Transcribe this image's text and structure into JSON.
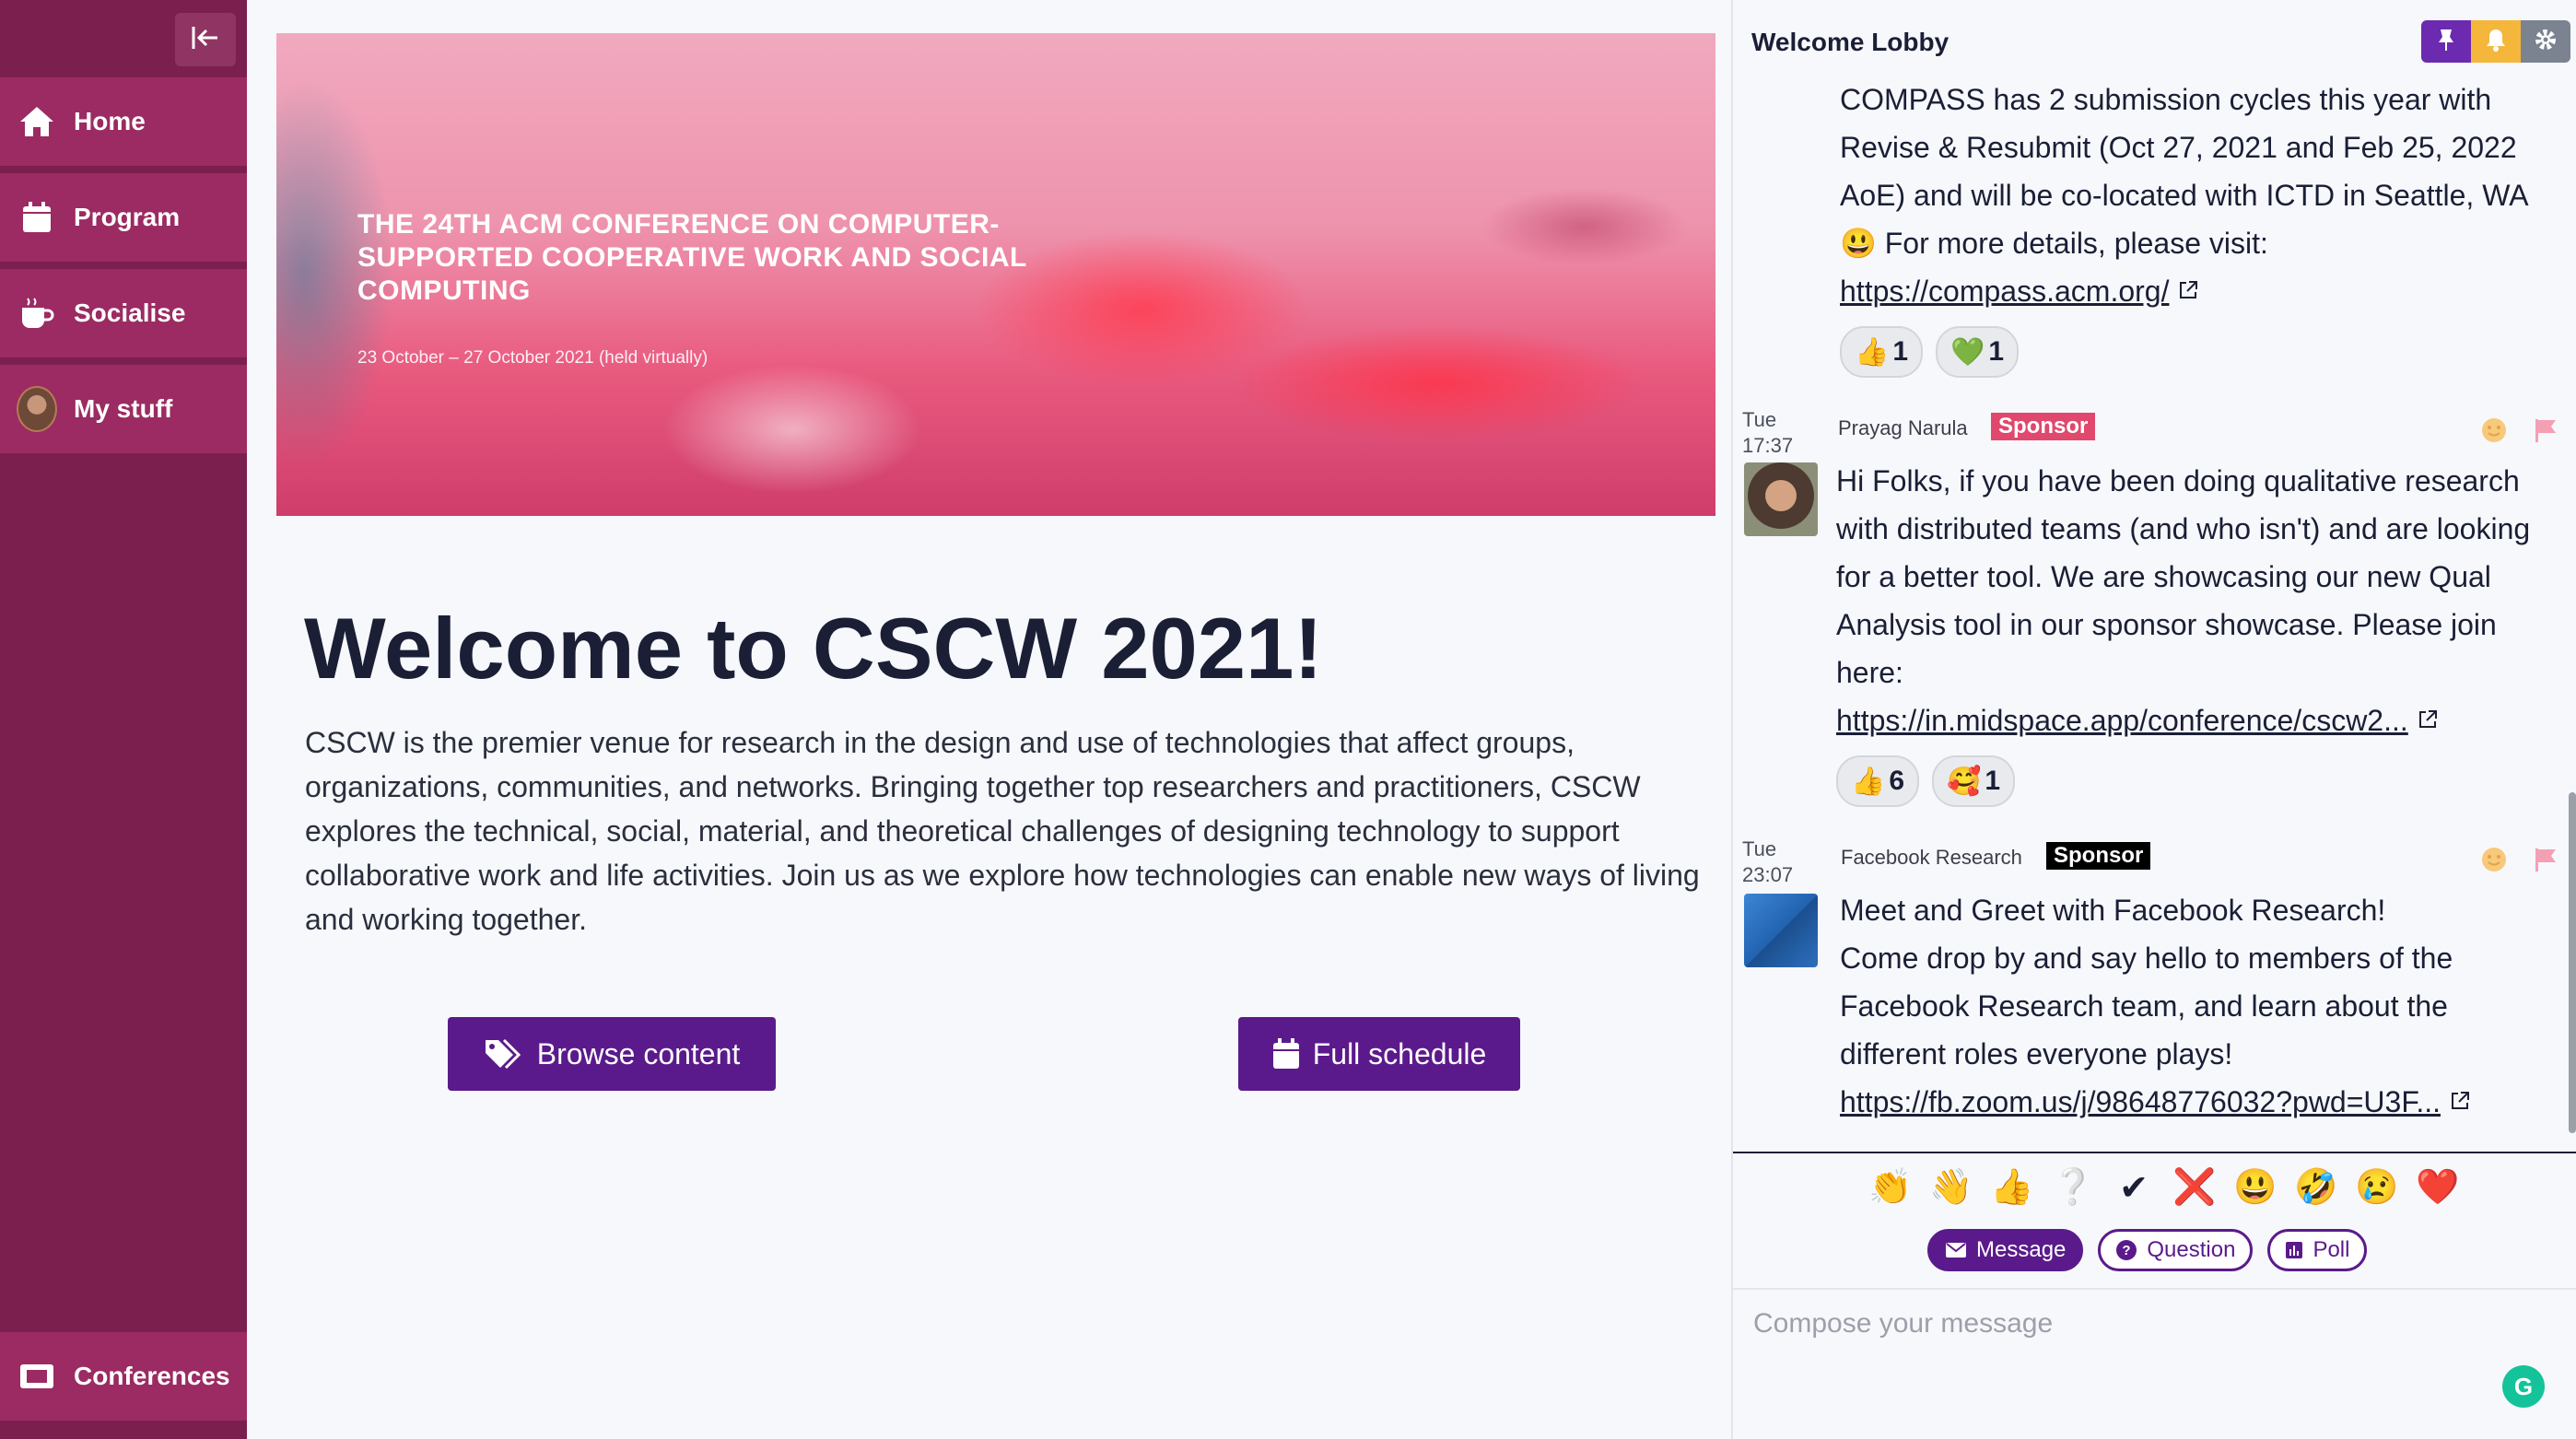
{
  "sidebar": {
    "items": [
      {
        "label": "Home",
        "icon": "home-icon"
      },
      {
        "label": "Program",
        "icon": "calendar-icon"
      },
      {
        "label": "Socialise",
        "icon": "coffee-icon"
      },
      {
        "label": "My stuff",
        "icon": "avatar"
      }
    ],
    "bottom_label": "Conferences",
    "color": "#7b1f4f",
    "item_color": "#9b2b62"
  },
  "banner": {
    "title": "THE 24TH ACM CONFERENCE ON COMPUTER-SUPPORTED COOPERATIVE WORK AND SOCIAL COMPUTING",
    "date": "23 October – 27 October 2021 (held virtually)"
  },
  "main": {
    "title": "Welcome to CSCW 2021!",
    "intro": "CSCW is the premier venue for research in the design and use of technologies that affect groups, organizations, communities, and networks. Bringing together top researchers and practitioners, CSCW explores the technical, social, material, and theoretical challenges of designing technology to support collaborative work and life activities. Join us as we explore how technologies can enable new ways of living and working together.",
    "browse_label": "Browse content",
    "schedule_label": "Full schedule",
    "button_color": "#5b1a8b"
  },
  "chat": {
    "title": "Welcome Lobby",
    "messages": [
      {
        "text_lines": [
          "COMPASS has 2 submission cycles this year with",
          "Revise & Resubmit (Oct 27, 2021 and Feb 25, 2022",
          "AoE) and will be co-located with ICTD in Seattle, WA"
        ],
        "text_emoji_line": "😃 For more details, please visit:",
        "link": "https://compass.acm.org/",
        "reactions": [
          {
            "emoji": "👍",
            "count": "1"
          },
          {
            "emoji": "💚",
            "count": "1"
          }
        ]
      },
      {
        "day": "Tue",
        "time": "17:37",
        "sender": "Prayag Narula",
        "badge": "Sponsor",
        "badge_color": "#e0486d",
        "text": "Hi Folks, if you have been doing qualitative research with distributed teams (and who isn't) and are looking for a better tool. We are showcasing our new Qual Analysis tool in our sponsor showcase. Please join here:",
        "link": "https://in.midspace.app/conference/cscw2...",
        "reactions": [
          {
            "emoji": "👍",
            "count": "6"
          },
          {
            "emoji": "🥰",
            "count": "1"
          }
        ]
      },
      {
        "day": "Tue",
        "time": "23:07",
        "sender": "Facebook Research",
        "badge": "Sponsor",
        "badge_color": "#000000",
        "text_line1": "Meet and Greet with Facebook Research!",
        "text": "Come drop by and say hello to members of the Facebook Research team, and learn about the different roles everyone plays!",
        "link": "https://fb.zoom.us/j/98648776032?pwd=U3F..."
      }
    ],
    "quick_emojis": [
      "👏",
      "👋",
      "👍",
      "❔",
      "✔",
      "❌",
      "😃",
      "🤣",
      "😢",
      "❤️"
    ],
    "type_buttons": {
      "message": "Message",
      "question": "Question",
      "poll": "Poll"
    },
    "compose_placeholder": "Compose your message"
  }
}
